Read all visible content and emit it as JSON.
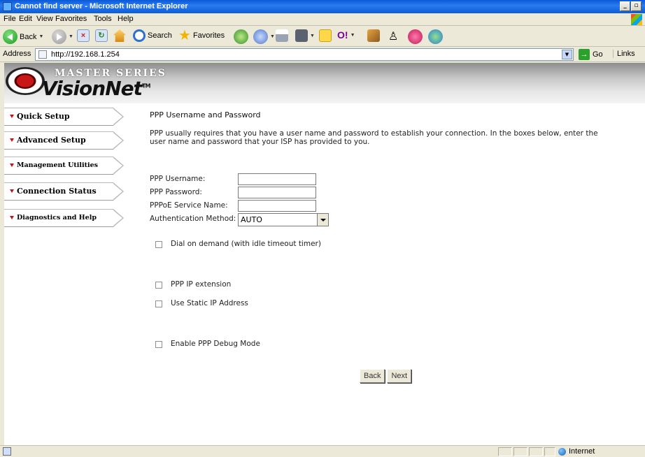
{
  "window": {
    "title": "Cannot find server - Microsoft Internet Explorer",
    "minimize": "_",
    "restore": "▫"
  },
  "menu": [
    "File",
    "Edit",
    "View",
    "Favorites",
    "Tools",
    "Help"
  ],
  "toolbar": {
    "back": "Back",
    "search": "Search",
    "favorites": "Favorites"
  },
  "address": {
    "label": "Address",
    "url": "http://192.168.1.254",
    "go": "Go",
    "links": "Links"
  },
  "brand": {
    "series": "MASTER SERIES",
    "name": "VisionNet",
    "tm": "TM"
  },
  "nav": [
    {
      "label": "Quick Setup"
    },
    {
      "label": "Advanced Setup"
    },
    {
      "label": "Management Utilities"
    },
    {
      "label": "Connection Status"
    },
    {
      "label": "Diagnostics and Help"
    }
  ],
  "page": {
    "heading": "PPP Username and Password",
    "description": "PPP usually requires that you have a user name and password to establish your connection. In the boxes below, enter the user name and password that your ISP has provided to you.",
    "username_label": "PPP Username:",
    "password_label": "PPP Password:",
    "service_label": "PPPoE Service Name:",
    "auth_label": "Authentication Method:",
    "auth_value": "AUTO",
    "username_value": "",
    "password_value": "",
    "service_value": "",
    "dial_on_demand": "Dial on demand (with idle timeout timer)",
    "ip_extension": "PPP IP extension",
    "static_ip": "Use Static IP Address",
    "debug_mode": "Enable PPP Debug Mode",
    "back_button": "Back",
    "next_button": "Next"
  },
  "status": {
    "zone": "Internet"
  }
}
